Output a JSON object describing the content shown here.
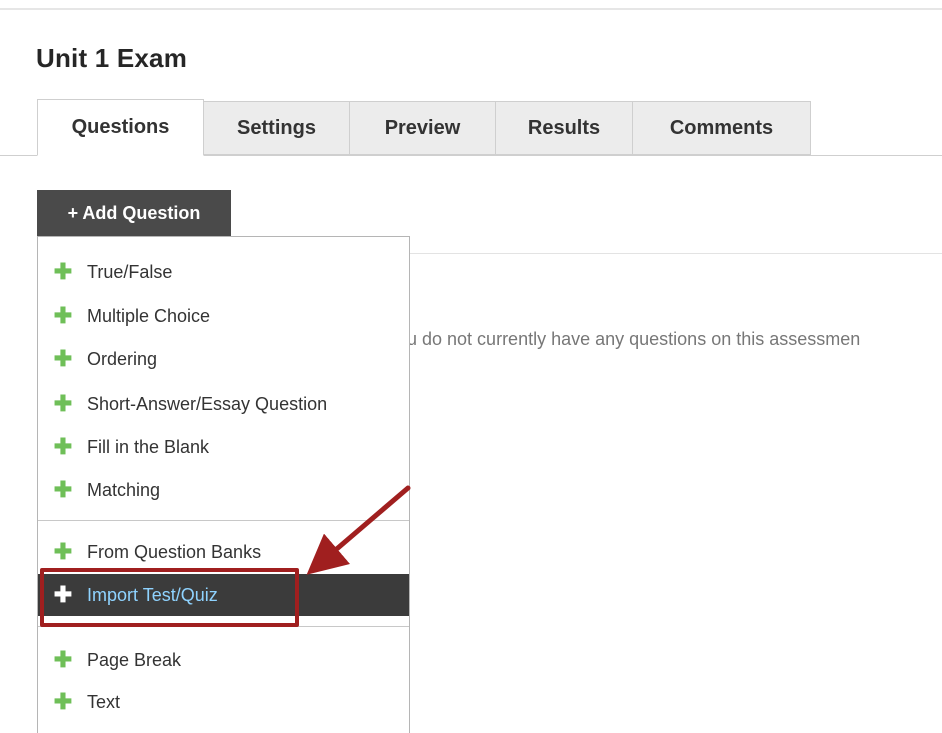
{
  "page": {
    "title": "Unit 1 Exam"
  },
  "tabs": [
    {
      "label": "Questions",
      "active": true
    },
    {
      "label": "Settings",
      "active": false
    },
    {
      "label": "Preview",
      "active": false
    },
    {
      "label": "Results",
      "active": false
    },
    {
      "label": "Comments",
      "active": false
    }
  ],
  "add_question": {
    "label": "+ Add Question"
  },
  "empty_message": "u do not currently have any questions on this assessmen",
  "menu": {
    "items": [
      {
        "label": "True/False",
        "icon": "plus-icon"
      },
      {
        "label": "Multiple Choice",
        "icon": "plus-icon"
      },
      {
        "label": "Ordering",
        "icon": "plus-icon"
      },
      {
        "label": "Short-Answer/Essay Question",
        "icon": "plus-icon"
      },
      {
        "label": "Fill in the Blank",
        "icon": "plus-icon"
      },
      {
        "label": "Matching",
        "icon": "plus-icon"
      },
      {
        "label": "From Question Banks",
        "icon": "plus-icon"
      },
      {
        "label": "Import Test/Quiz",
        "icon": "plus-icon",
        "highlighted": true
      },
      {
        "label": "Page Break",
        "icon": "plus-icon"
      },
      {
        "label": "Text",
        "icon": "plus-icon"
      }
    ]
  },
  "colors": {
    "plus_icon": "#6fbf58",
    "highlight_bg": "#3b3b3b",
    "highlight_text": "#8fd3ff",
    "annotation": "#a01f1f",
    "button_bg": "#4a4a4a"
  }
}
